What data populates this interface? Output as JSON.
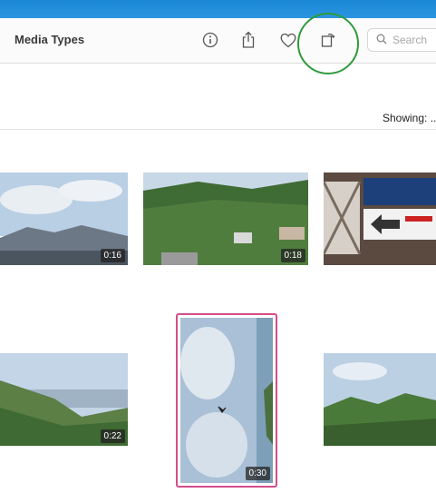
{
  "toolbar": {
    "title": "Media Types",
    "search_placeholder": "Search",
    "icons": [
      "info-icon",
      "share-icon",
      "heart-icon",
      "rotate-icon",
      "search-icon"
    ]
  },
  "status": {
    "showing": "Showing: ..."
  },
  "thumbnails": [
    {
      "duration": "0:16"
    },
    {
      "duration": "0:18"
    },
    {
      "duration": ""
    },
    {
      "duration": "0:22"
    },
    {
      "duration": "0:30",
      "selected": true
    },
    {
      "duration": ""
    }
  ],
  "colors": {
    "selection": "#d44d8c",
    "annotation": "#2f9a3a",
    "top_bar": "#1f8ce0"
  }
}
